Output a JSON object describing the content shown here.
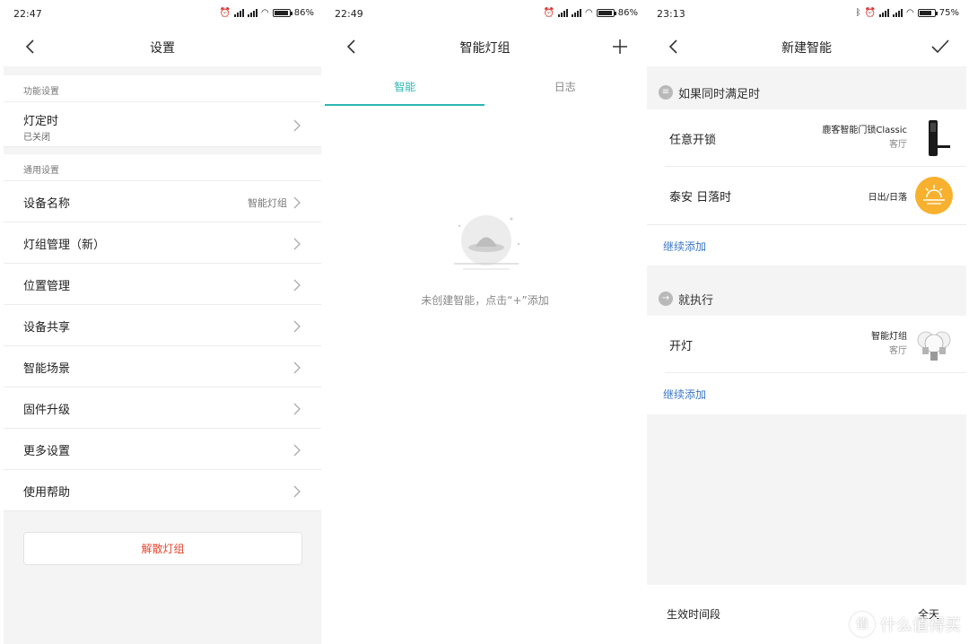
{
  "panels": [
    {
      "status": {
        "time": "22:47",
        "battery": "86%",
        "battery_level": 0.86
      },
      "nav": {
        "title": "设置"
      },
      "section1": {
        "label": "功能设置"
      },
      "timer": {
        "label": "灯定时",
        "sub": "已关闭"
      },
      "section2": {
        "label": "通用设置"
      },
      "rows": [
        {
          "label": "设备名称",
          "value": "智能灯组"
        },
        {
          "label": "灯组管理（新）",
          "value": ""
        },
        {
          "label": "位置管理",
          "value": ""
        },
        {
          "label": "设备共享",
          "value": ""
        },
        {
          "label": "智能场景",
          "value": ""
        },
        {
          "label": "固件升级",
          "value": ""
        },
        {
          "label": "更多设置",
          "value": ""
        },
        {
          "label": "使用帮助",
          "value": ""
        }
      ],
      "disband_label": "解散灯组"
    },
    {
      "status": {
        "time": "22:49",
        "battery": "86%",
        "battery_level": 0.86
      },
      "nav": {
        "title": "智能灯组"
      },
      "tabs": [
        {
          "label": "智能"
        },
        {
          "label": "日志"
        }
      ],
      "empty_text": "未创建智能，点击“+”添加"
    },
    {
      "status": {
        "time": "23:13",
        "battery": "75%",
        "battery_level": 0.75
      },
      "nav": {
        "title": "新建智能"
      },
      "condition_header": "如果同时满足时",
      "conditions": [
        {
          "name": "任意开锁",
          "device": "鹿客智能门锁Classic",
          "room": "客厅",
          "icon": "door-lock-icon"
        },
        {
          "name": "泰安 日落时",
          "device": "日出/日落",
          "room": "",
          "icon": "sunset-icon"
        }
      ],
      "add_more": "继续添加",
      "action_header": "就执行",
      "actions": [
        {
          "name": "开灯",
          "device": "智能灯组",
          "room": "客厅",
          "icon": "light-bulbs-icon"
        }
      ],
      "add_more_2": "继续添加",
      "effective_period": {
        "label": "生效时间段",
        "value": "全天"
      }
    }
  ],
  "colors": {
    "accent": "#2bb7b3",
    "danger": "#e8462f",
    "link": "#3a78c8",
    "sun": "#f7b12e"
  },
  "watermark": "什么值得买"
}
